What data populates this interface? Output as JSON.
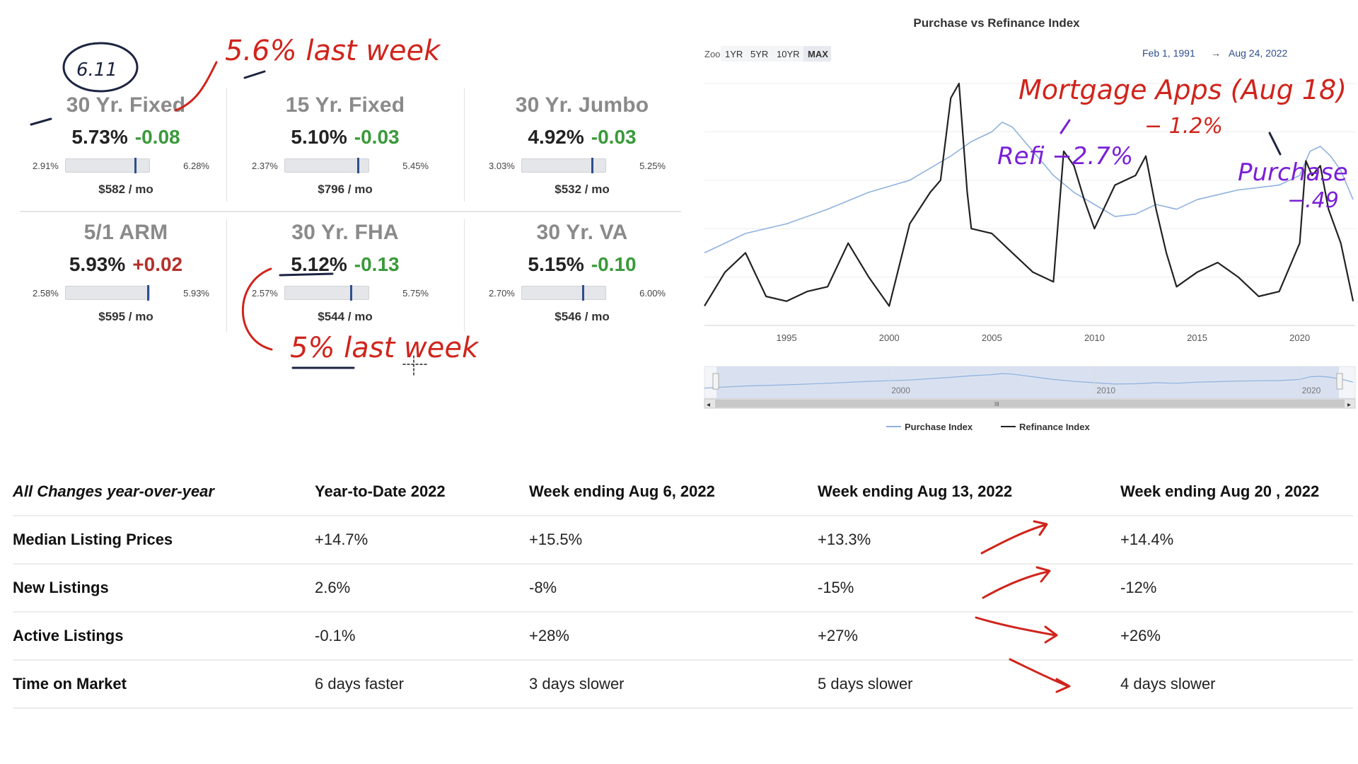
{
  "rates": [
    {
      "title": "30 Yr. Fixed",
      "value": "5.73%",
      "change": "-0.08",
      "direction": "down",
      "min": "2.91%",
      "max": "6.28%",
      "position": 0.84,
      "payment": "$582 / mo"
    },
    {
      "title": "15 Yr. Fixed",
      "value": "5.10%",
      "change": "-0.03",
      "direction": "down",
      "min": "2.37%",
      "max": "5.45%",
      "position": 0.89,
      "payment": "$796 / mo"
    },
    {
      "title": "30 Yr. Jumbo",
      "value": "4.92%",
      "change": "-0.03",
      "direction": "down",
      "min": "3.03%",
      "max": "5.25%",
      "position": 0.85,
      "payment": "$532 / mo"
    },
    {
      "title": "5/1 ARM",
      "value": "5.93%",
      "change": "+0.02",
      "direction": "up",
      "min": "2.58%",
      "max": "5.93%",
      "position": 1.0,
      "payment": "$595 / mo"
    },
    {
      "title": "30 Yr. FHA",
      "value": "5.12%",
      "change": "-0.13",
      "direction": "down",
      "min": "2.57%",
      "max": "5.75%",
      "position": 0.8,
      "payment": "$544 / mo"
    },
    {
      "title": "30 Yr. VA",
      "value": "5.15%",
      "change": "-0.10",
      "direction": "down",
      "min": "2.70%",
      "max": "6.00%",
      "position": 0.74,
      "payment": "$546 / mo"
    }
  ],
  "colors": {
    "down": "#3a9a3a",
    "up": "#b5302b",
    "purchase": "#8fb1dd",
    "refinance": "#222222",
    "accent": "#2f4f8a",
    "annotation_red": "#d0241c",
    "annotation_purple": "#7a1fd6",
    "annotation_navy": "#1b2440"
  },
  "chart": {
    "title": "Purchase vs Refinance Index",
    "zoom_label": "Zoom",
    "zoom_buttons": [
      "1YR",
      "5YR",
      "10YR",
      "MAX"
    ],
    "zoom_active": "MAX",
    "date_from": "Feb 1, 1991",
    "date_arrow": "→",
    "date_to": "Aug 24, 2022",
    "x_ticks": [
      "1995",
      "2000",
      "2005",
      "2010",
      "2015",
      "2020"
    ],
    "navigator_ticks": [
      "2000",
      "2010",
      "2020"
    ],
    "navigator_grip": "III",
    "legend": [
      "Purchase Index",
      "Refinance Index"
    ]
  },
  "chart_data": {
    "type": "line",
    "title": "Purchase vs Refinance Index",
    "x_range": [
      "1991-02",
      "2022-08"
    ],
    "grid": true,
    "legend_position": "bottom",
    "series": [
      {
        "name": "Purchase Index",
        "x": [
          1991,
          1993,
          1995,
          1997,
          1999,
          2001,
          2003,
          2004,
          2005,
          2005.5,
          2006,
          2007,
          2008,
          2009,
          2010,
          2011,
          2012,
          2013,
          2014,
          2015,
          2016,
          2017,
          2018,
          2019,
          2020,
          2020.5,
          2021,
          2021.5,
          2022,
          2022.6
        ],
        "y": [
          0.3,
          0.38,
          0.42,
          0.48,
          0.55,
          0.6,
          0.7,
          0.76,
          0.8,
          0.84,
          0.82,
          0.72,
          0.62,
          0.55,
          0.5,
          0.45,
          0.46,
          0.5,
          0.48,
          0.52,
          0.54,
          0.56,
          0.57,
          0.58,
          0.62,
          0.72,
          0.74,
          0.7,
          0.64,
          0.52
        ]
      },
      {
        "name": "Refinance Index",
        "x": [
          1991,
          1992,
          1993,
          1994,
          1995,
          1996,
          1997,
          1998,
          1999,
          2000,
          2001,
          2002,
          2002.5,
          2003,
          2003.4,
          2003.8,
          2004,
          2005,
          2006,
          2007,
          2008,
          2008.5,
          2009,
          2009.5,
          2010,
          2011,
          2012,
          2012.5,
          2013,
          2013.5,
          2014,
          2015,
          2016,
          2017,
          2018,
          2019,
          2020,
          2020.3,
          2020.6,
          2021,
          2021.4,
          2022,
          2022.6
        ],
        "y": [
          0.08,
          0.22,
          0.3,
          0.12,
          0.1,
          0.14,
          0.16,
          0.34,
          0.2,
          0.08,
          0.42,
          0.55,
          0.6,
          0.94,
          1.0,
          0.55,
          0.4,
          0.38,
          0.3,
          0.22,
          0.18,
          0.72,
          0.66,
          0.52,
          0.4,
          0.58,
          0.62,
          0.7,
          0.48,
          0.3,
          0.16,
          0.22,
          0.26,
          0.2,
          0.12,
          0.14,
          0.34,
          0.68,
          0.62,
          0.66,
          0.48,
          0.34,
          0.1
        ]
      }
    ]
  },
  "table": {
    "headers": [
      "All Changes year-over-year",
      "Year-to-Date 2022",
      "Week ending Aug 6, 2022",
      "Week ending Aug 13, 2022",
      "Week ending Aug 20 , 2022"
    ],
    "rows": [
      [
        "Median Listing Prices",
        "+14.7%",
        "+15.5%",
        "+13.3%",
        "+14.4%"
      ],
      [
        "New Listings",
        "2.6%",
        "-8%",
        "-15%",
        "-12%"
      ],
      [
        "Active Listings",
        "-0.1%",
        "+28%",
        "+27%",
        "+26%"
      ],
      [
        "Time on Market",
        "6 days faster",
        "3 days slower",
        "5 days slower",
        "4 days slower"
      ]
    ]
  },
  "annotations": {
    "circled_rate": "6.11",
    "fixed_last_week": "5.6% last week",
    "fha_last_week": "5% last week",
    "mortgage_apps": "Mortgage Apps (Aug 18)",
    "apps_change": "− 1.2%",
    "refi": "Refi −2.7%",
    "purchase": "Purchase",
    "purchase_change": "−.49"
  }
}
